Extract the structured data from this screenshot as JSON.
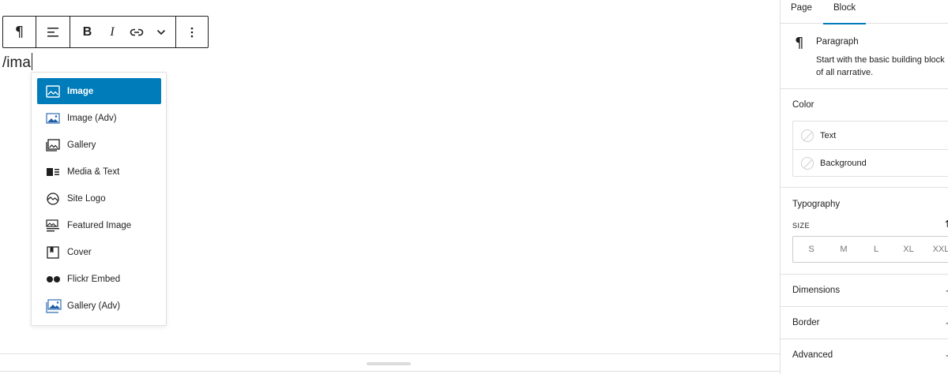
{
  "editor": {
    "text": "/ima"
  },
  "toolbar": {
    "paragraph_glyph": "¶",
    "bold_label": "B",
    "italic_label": "I"
  },
  "inserter": {
    "items": [
      {
        "label": "Image",
        "icon": "image-icon",
        "selected": true
      },
      {
        "label": "Image (Adv)",
        "icon": "image-adv-icon",
        "selected": false
      },
      {
        "label": "Gallery",
        "icon": "gallery-icon",
        "selected": false
      },
      {
        "label": "Media & Text",
        "icon": "media-text-icon",
        "selected": false
      },
      {
        "label": "Site Logo",
        "icon": "site-logo-icon",
        "selected": false
      },
      {
        "label": "Featured Image",
        "icon": "featured-image-icon",
        "selected": false
      },
      {
        "label": "Cover",
        "icon": "cover-icon",
        "selected": false
      },
      {
        "label": "Flickr Embed",
        "icon": "flickr-icon",
        "selected": false
      },
      {
        "label": "Gallery (Adv)",
        "icon": "gallery-adv-icon",
        "selected": false
      }
    ]
  },
  "sidebar": {
    "tabs": [
      {
        "label": "Page",
        "active": false
      },
      {
        "label": "Block",
        "active": true
      }
    ],
    "block": {
      "glyph": "¶",
      "title": "Paragraph",
      "description_line1": "Start with the basic building block",
      "description_line2": "of all narrative."
    },
    "color": {
      "title": "Color",
      "items": [
        "Text",
        "Background"
      ]
    },
    "typography": {
      "title": "Typography",
      "size_label": "SIZE",
      "sizes": [
        "S",
        "M",
        "L",
        "XL",
        "XXL"
      ]
    },
    "sections": [
      "Dimensions",
      "Border",
      "Advanced"
    ]
  },
  "colors": {
    "accent": "#007cba",
    "text": "#1e1e1e",
    "border": "#e0e0e0"
  }
}
